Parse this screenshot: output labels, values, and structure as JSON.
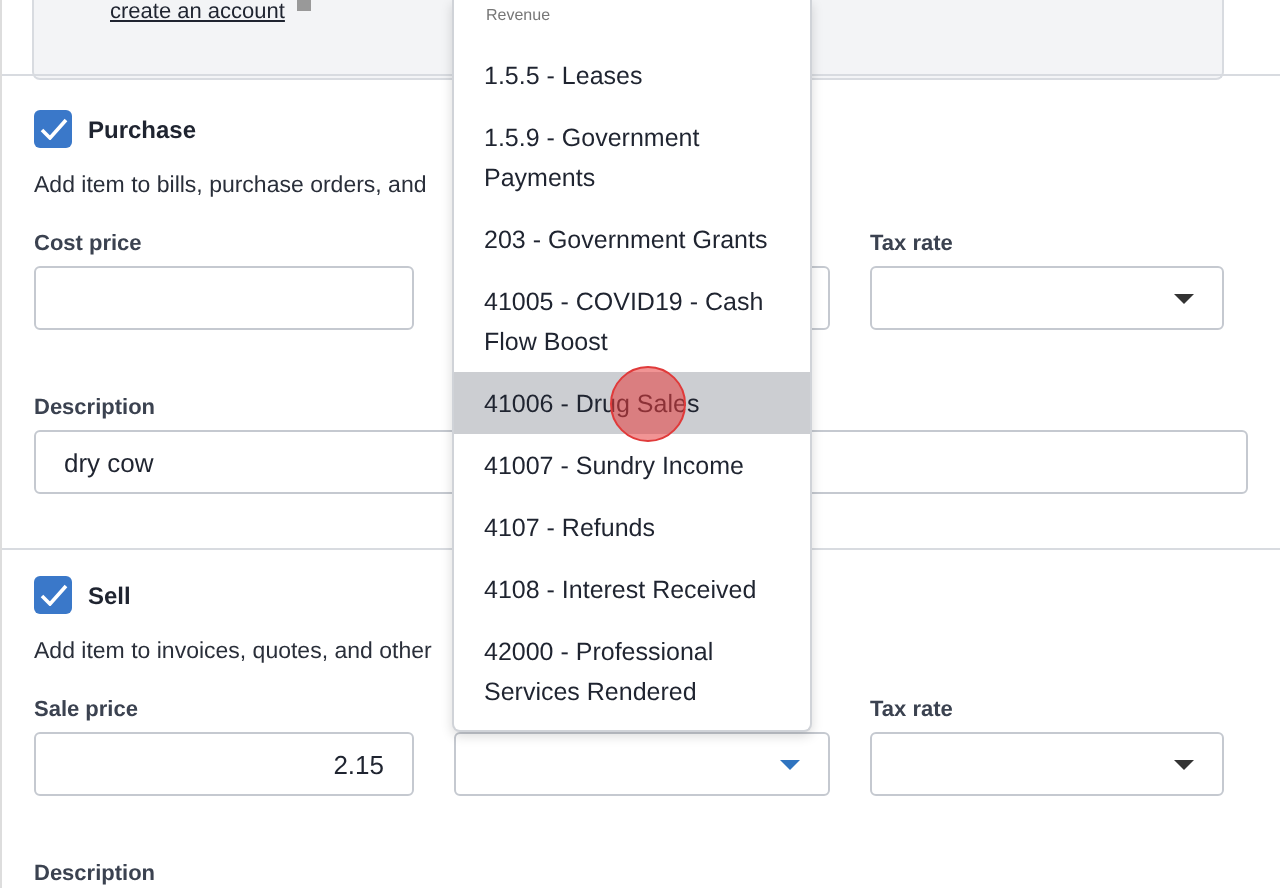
{
  "top_panel": {
    "link": "create an account"
  },
  "sections": [
    {
      "title": "Purchase",
      "checked": true,
      "description": "Add item to bills, purchase orders, and",
      "price_label": "Cost price",
      "account_focused": false,
      "tax_label": "Tax rate",
      "description_label": "Description",
      "description_value": "dry cow"
    },
    {
      "title": "Sell",
      "checked": true,
      "description": "Add item to invoices, quotes, and other",
      "price_label": "Sale price",
      "price_value": "2.15",
      "account_focused": true,
      "tax_label": "Tax rate",
      "description_label": "Description"
    }
  ],
  "dropdown": {
    "group": "Revenue",
    "items": [
      {
        "label": "1.5.5 - Leases",
        "selected": false
      },
      {
        "label": "1.5.9 - Government Payments",
        "selected": false
      },
      {
        "label": "203 - Government Grants",
        "selected": false
      },
      {
        "label": "41005 - COVID19 - Cash Flow Boost",
        "selected": false
      },
      {
        "label": "41006 - Drug Sales",
        "selected": true
      },
      {
        "label": "41007 - Sundry Income",
        "selected": false
      },
      {
        "label": "4107 - Refunds",
        "selected": false
      },
      {
        "label": "4108 - Interest Received",
        "selected": false
      },
      {
        "label": "42000 - Professional Services Rendered",
        "selected": false
      }
    ]
  }
}
